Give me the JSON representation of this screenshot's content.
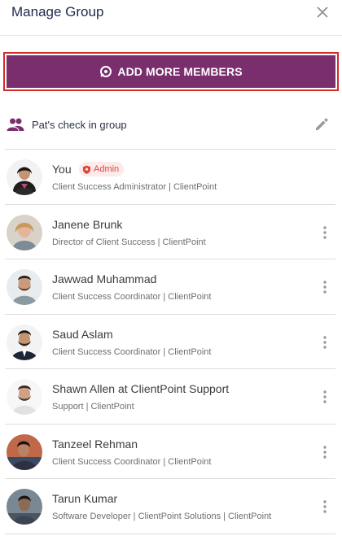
{
  "header": {
    "title": "Manage Group"
  },
  "add_button": {
    "label": "ADD MORE MEMBERS"
  },
  "group": {
    "name": "Pat's check in group"
  },
  "members": [
    {
      "name": "You",
      "role": "Client Success Administrator | ClientPoint",
      "badge": "Admin"
    },
    {
      "name": "Janene Brunk",
      "role": "Director of Client Success | ClientPoint"
    },
    {
      "name": "Jawwad Muhammad",
      "role": "Client Success Coordinator | ClientPoint"
    },
    {
      "name": "Saud Aslam",
      "role": "Client Success Coordinator | ClientPoint"
    },
    {
      "name": "Shawn Allen at ClientPoint Support",
      "role": "Support | ClientPoint"
    },
    {
      "name": "Tanzeel Rehman",
      "role": "Client Success Coordinator | ClientPoint"
    },
    {
      "name": "Tarun Kumar",
      "role": "Software Developer | ClientPoint Solutions | ClientPoint"
    }
  ],
  "colors": {
    "accent": "#7a2e6e",
    "title": "#1d2a4d",
    "badge_text": "#e0453c",
    "badge_bg": "#fdeaea"
  },
  "icons": [
    "close-icon",
    "add-member-icon",
    "group-icon",
    "edit-icon",
    "shield-icon",
    "more-vert-icon"
  ]
}
